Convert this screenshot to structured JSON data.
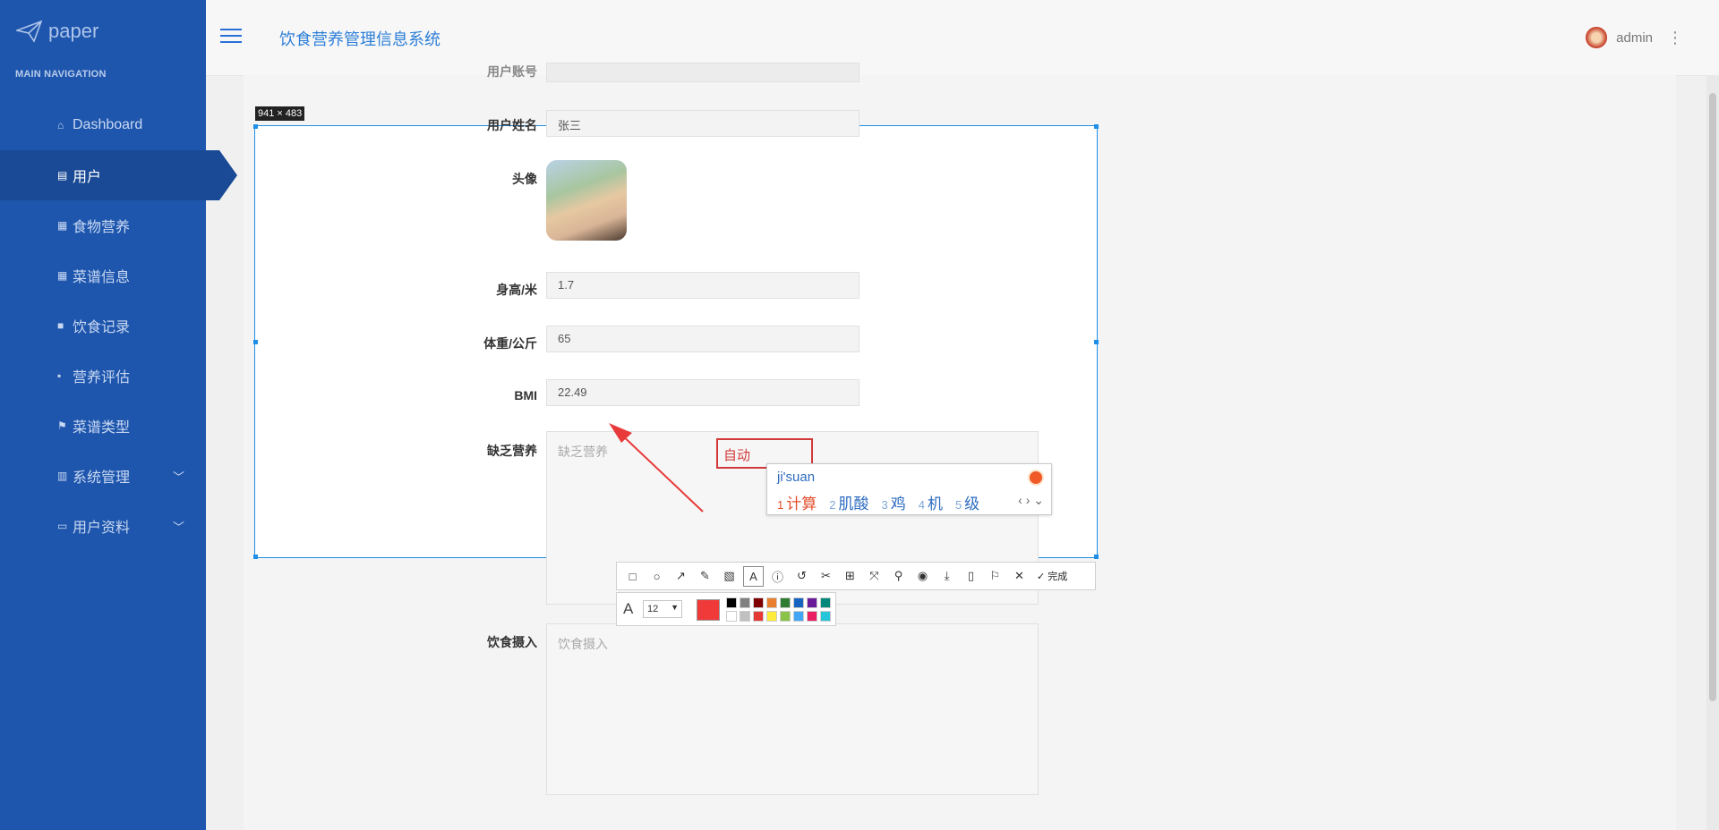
{
  "sidebar": {
    "logo_text": "paper",
    "nav_heading": "MAIN NAVIGATION",
    "items": [
      {
        "label": "Dashboard",
        "icon": "home-icon"
      },
      {
        "label": "用户",
        "icon": "clipboard-icon"
      },
      {
        "label": "食物营养",
        "icon": "table-icon"
      },
      {
        "label": "菜谱信息",
        "icon": "grid-icon"
      },
      {
        "label": "饮食记录",
        "icon": "book-icon"
      },
      {
        "label": "营养评估",
        "icon": "database-icon"
      },
      {
        "label": "菜谱类型",
        "icon": "flag-icon"
      },
      {
        "label": "系统管理",
        "icon": "bar-chart-icon"
      },
      {
        "label": "用户资料",
        "icon": "id-card-icon"
      }
    ]
  },
  "header": {
    "title": "饮食营养管理信息系统",
    "username": "admin"
  },
  "form": {
    "account_label": "用户账号",
    "name_label": "用户姓名",
    "name_value": "张三",
    "avatar_label": "头像",
    "height_label": "身高/米",
    "height_value": "1.7",
    "weight_label": "体重/公斤",
    "weight_value": "65",
    "bmi_label": "BMI",
    "bmi_value": "22.49",
    "lack_label": "缺乏营养",
    "lack_placeholder": "缺乏营养",
    "diet_label": "饮食摄入",
    "diet_placeholder": "饮食摄入"
  },
  "screenshot_tool": {
    "dimensions": "941 × 483",
    "text_annotation": "自动",
    "done_label": "完成",
    "font_size": "12",
    "current_color": "#f03a3a",
    "palette": [
      "#000000",
      "#808080",
      "#800000",
      "#e87e2e",
      "#2e7d32",
      "#1565c0",
      "#6a1b9a",
      "#00897b",
      "#ffffff",
      "#c0c0c0",
      "#e53935",
      "#ffeb3b",
      "#8bc34a",
      "#42a5f5",
      "#e91e63",
      "#26c6da"
    ]
  },
  "ime": {
    "input": "ji'suan",
    "candidates": [
      {
        "num": "1",
        "text": "计算"
      },
      {
        "num": "2",
        "text": "肌酸"
      },
      {
        "num": "3",
        "text": "鸡"
      },
      {
        "num": "4",
        "text": "机"
      },
      {
        "num": "5",
        "text": "级"
      }
    ]
  }
}
